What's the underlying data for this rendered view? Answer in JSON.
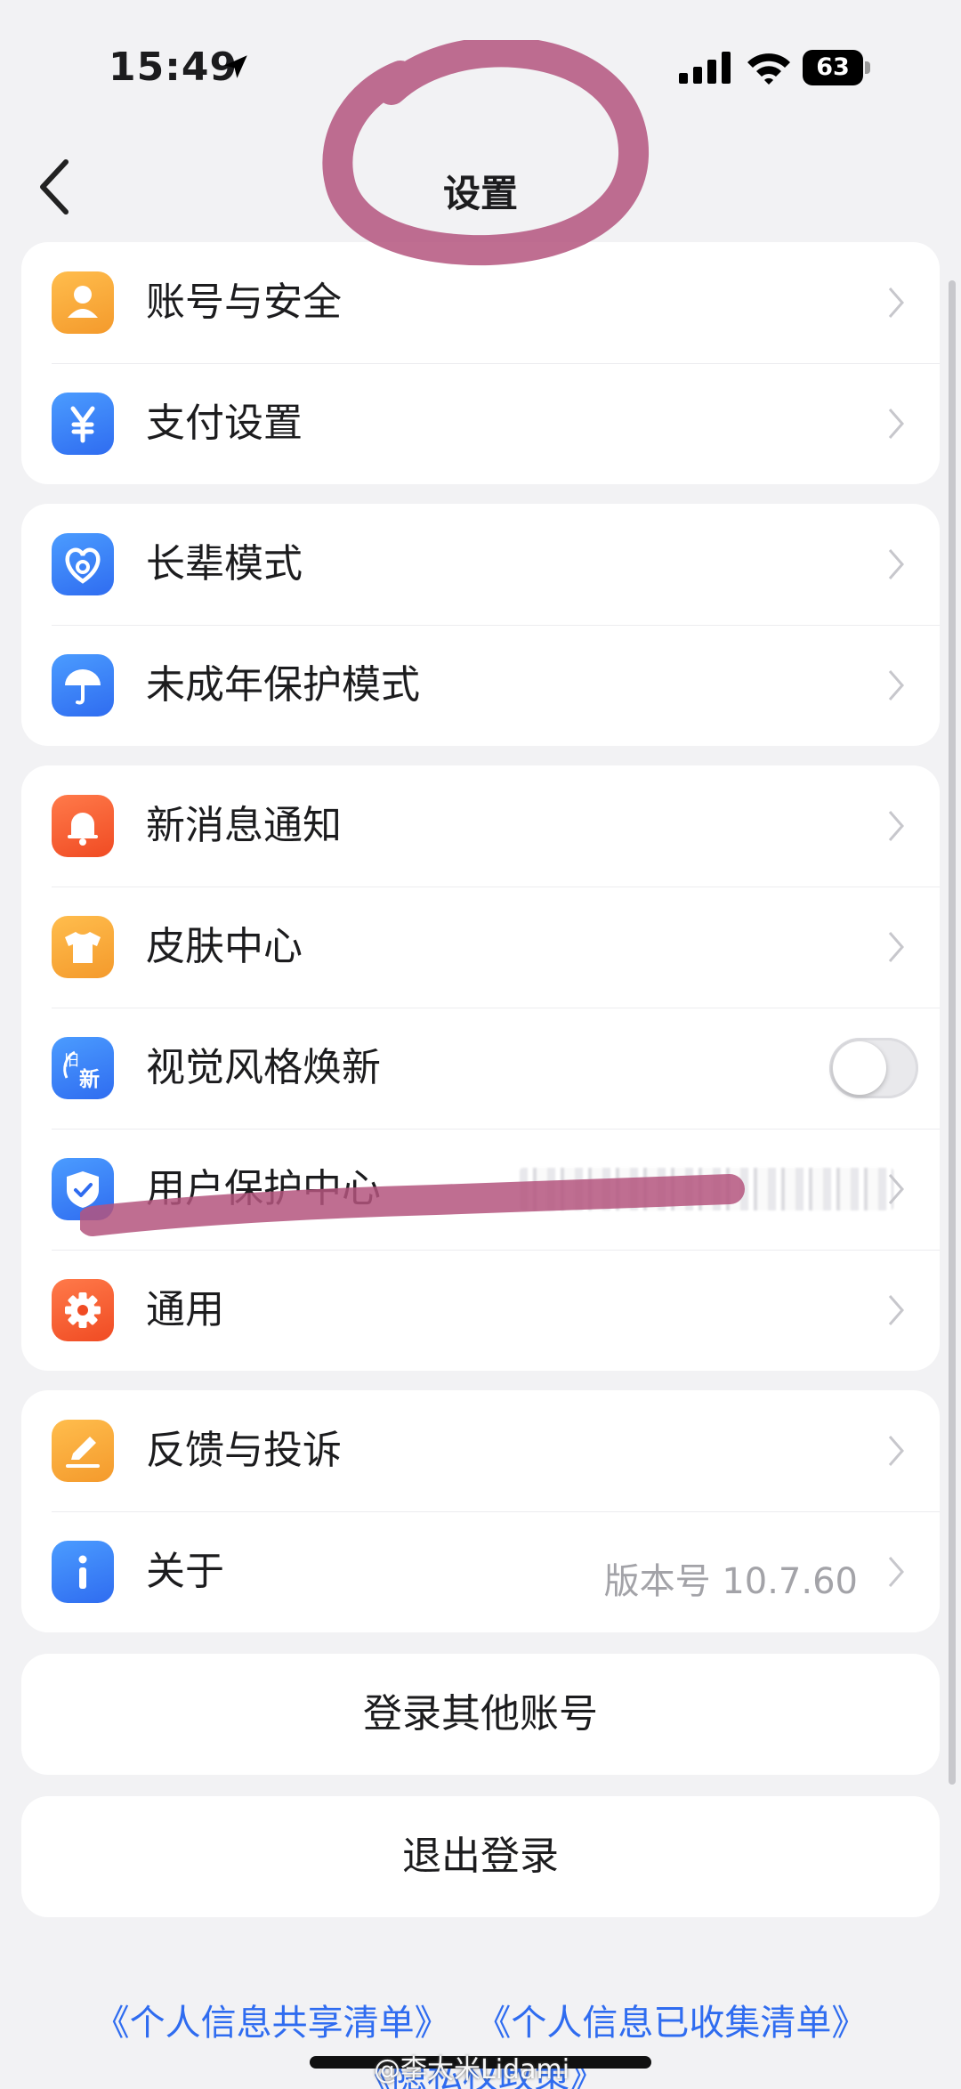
{
  "status_bar": {
    "time": "15:49",
    "battery": "63"
  },
  "nav": {
    "title": "设置"
  },
  "groups": [
    {
      "items": [
        {
          "label": "账号与安全",
          "icon": "user-icon"
        },
        {
          "label": "支付设置",
          "icon": "yen-icon"
        }
      ]
    },
    {
      "items": [
        {
          "label": "长辈模式",
          "icon": "heart-icon"
        },
        {
          "label": "未成年保护模式",
          "icon": "umbrella-icon"
        }
      ]
    },
    {
      "items": [
        {
          "label": "新消息通知",
          "icon": "bell-icon"
        },
        {
          "label": "皮肤中心",
          "icon": "shirt-icon"
        },
        {
          "label": "视觉风格焕新",
          "icon": "new-style-icon",
          "toggle": "off",
          "icon_text_top": "旧",
          "icon_text_bottom": "新"
        },
        {
          "label": "用户保护中心",
          "icon": "shield-icon"
        },
        {
          "label": "通用",
          "icon": "gear-icon"
        }
      ]
    },
    {
      "items": [
        {
          "label": "反馈与投诉",
          "icon": "edit-icon"
        },
        {
          "label": "关于",
          "icon": "info-icon",
          "value": "版本号 10.7.60"
        }
      ]
    }
  ],
  "actions": {
    "switch_account": "登录其他账号",
    "logout": "退出登录"
  },
  "footer": {
    "link_share": "《个人信息共享清单》",
    "link_collected": "《个人信息已收集清单》",
    "link_privacy": "《隐私权政策》",
    "watermark": "@李大米Lidami"
  },
  "colors": {
    "accent_link": "#2f6cf0",
    "orange_icon": "#f7a336",
    "blue_icon": "#3b82f6",
    "red_icon": "#f25a30",
    "annotation": "#b4557e"
  }
}
